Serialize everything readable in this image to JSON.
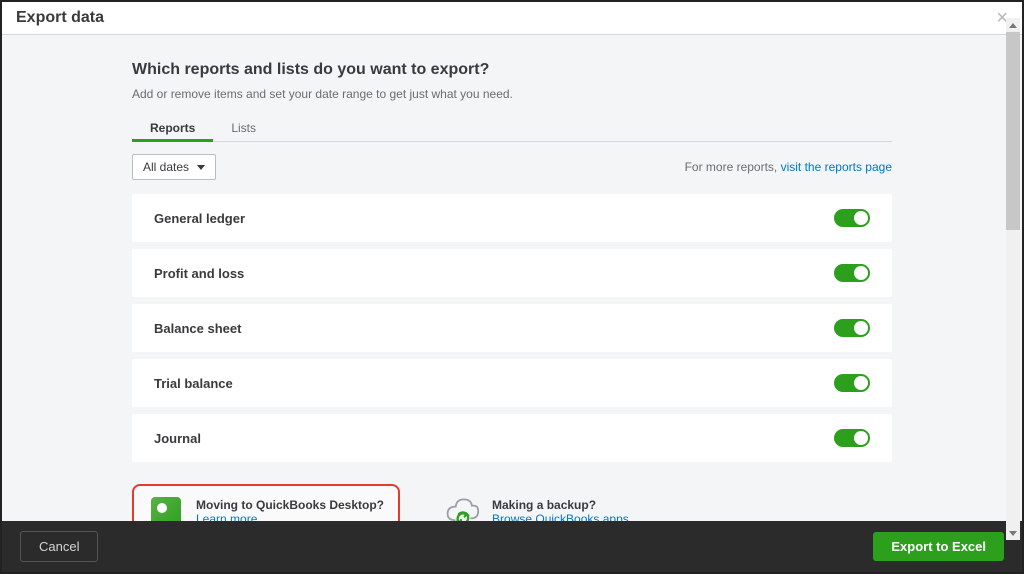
{
  "dialog": {
    "title": "Export data",
    "question": "Which reports and lists do you want to export?",
    "subtext": "Add or remove items and set your date range to get just what you need."
  },
  "tabs": {
    "items": [
      {
        "label": "Reports",
        "active": true
      },
      {
        "label": "Lists",
        "active": false
      }
    ]
  },
  "controls": {
    "date_label": "All dates",
    "more_text": "For more reports, ",
    "more_link": "visit the reports page"
  },
  "reports": [
    {
      "name": "General ledger",
      "enabled": true
    },
    {
      "name": "Profit and loss",
      "enabled": true
    },
    {
      "name": "Balance sheet",
      "enabled": true
    },
    {
      "name": "Trial balance",
      "enabled": true
    },
    {
      "name": "Journal",
      "enabled": true
    }
  ],
  "promos": {
    "desktop": {
      "title": "Moving to QuickBooks Desktop?",
      "link": "Learn more"
    },
    "backup": {
      "title": "Making a backup?",
      "link": "Browse QuickBooks apps"
    }
  },
  "footer": {
    "cancel": "Cancel",
    "export": "Export to Excel"
  }
}
